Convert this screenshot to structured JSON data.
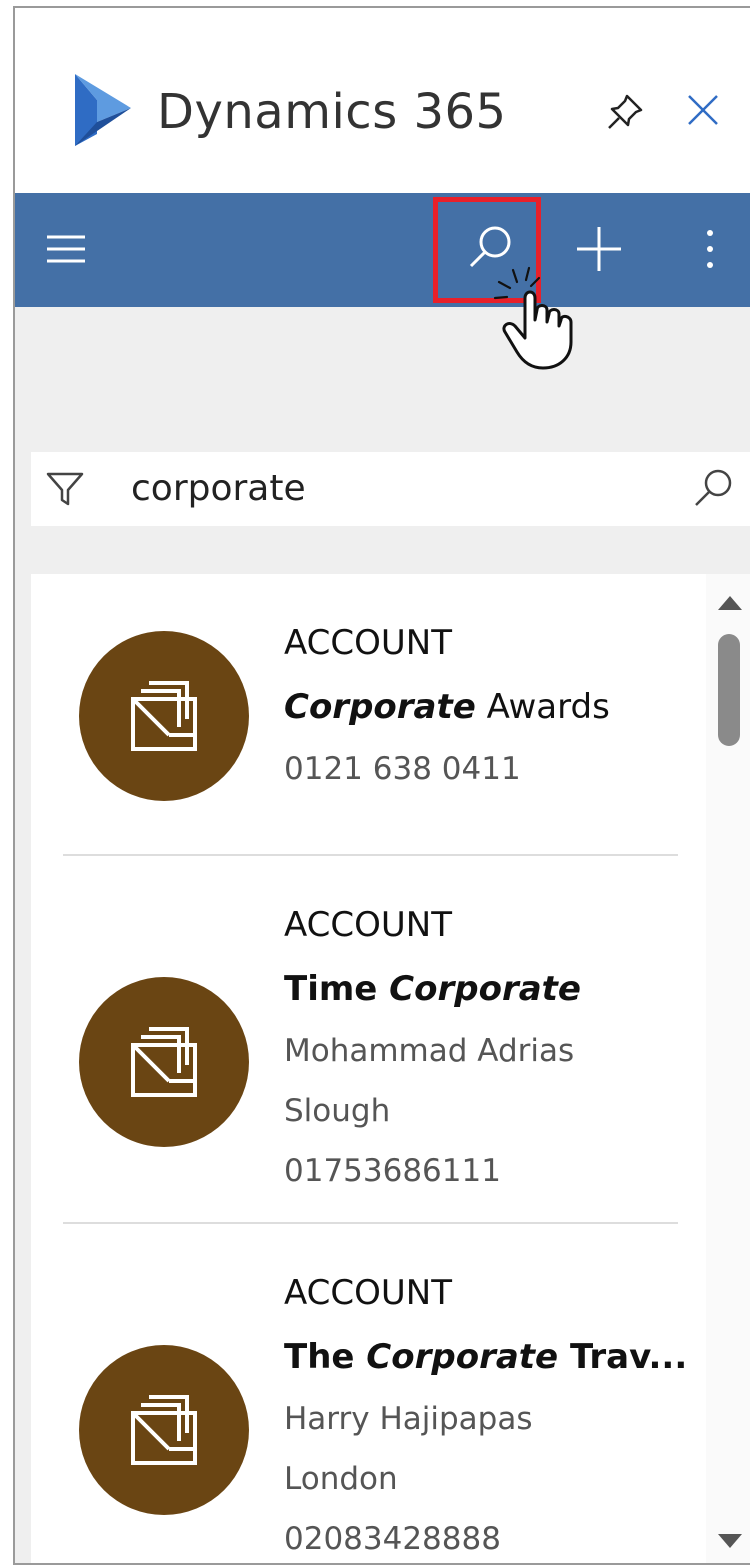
{
  "app": {
    "title": "Dynamics 365",
    "brand_color": "#4470a6",
    "logo_color": "#2f6cc4"
  },
  "header": {
    "pin_icon": "pin-icon",
    "close_icon": "close-icon"
  },
  "navbar": {
    "menu_icon": "hamburger-icon",
    "search_icon": "search-icon",
    "add_icon": "plus-icon",
    "more_icon": "more-vertical-icon",
    "highlight_color": "#e8202a"
  },
  "search": {
    "value": "corporate",
    "filter_icon": "filter-icon",
    "search_icon": "search-icon"
  },
  "results": [
    {
      "type": "ACCOUNT",
      "name_parts": [
        {
          "text": "Corporate",
          "match": true
        },
        {
          "text": " Awards",
          "match": false
        }
      ],
      "details": [
        "0121 638 0411"
      ],
      "avatar_color": "#6a4513"
    },
    {
      "type": "ACCOUNT",
      "name_parts": [
        {
          "text": "Time ",
          "match": false
        },
        {
          "text": "Corporate",
          "match": true
        }
      ],
      "details": [
        "Mohammad Adrias",
        "Slough",
        "01753686111"
      ],
      "avatar_color": "#6a4513"
    },
    {
      "type": "ACCOUNT",
      "name_parts": [
        {
          "text": "The ",
          "match": false
        },
        {
          "text": "Corporate",
          "match": true
        },
        {
          "text": " Trav...",
          "match": false
        }
      ],
      "details": [
        "Harry Hajipapas",
        "London",
        "02083428888"
      ],
      "avatar_color": "#6a4513"
    }
  ]
}
